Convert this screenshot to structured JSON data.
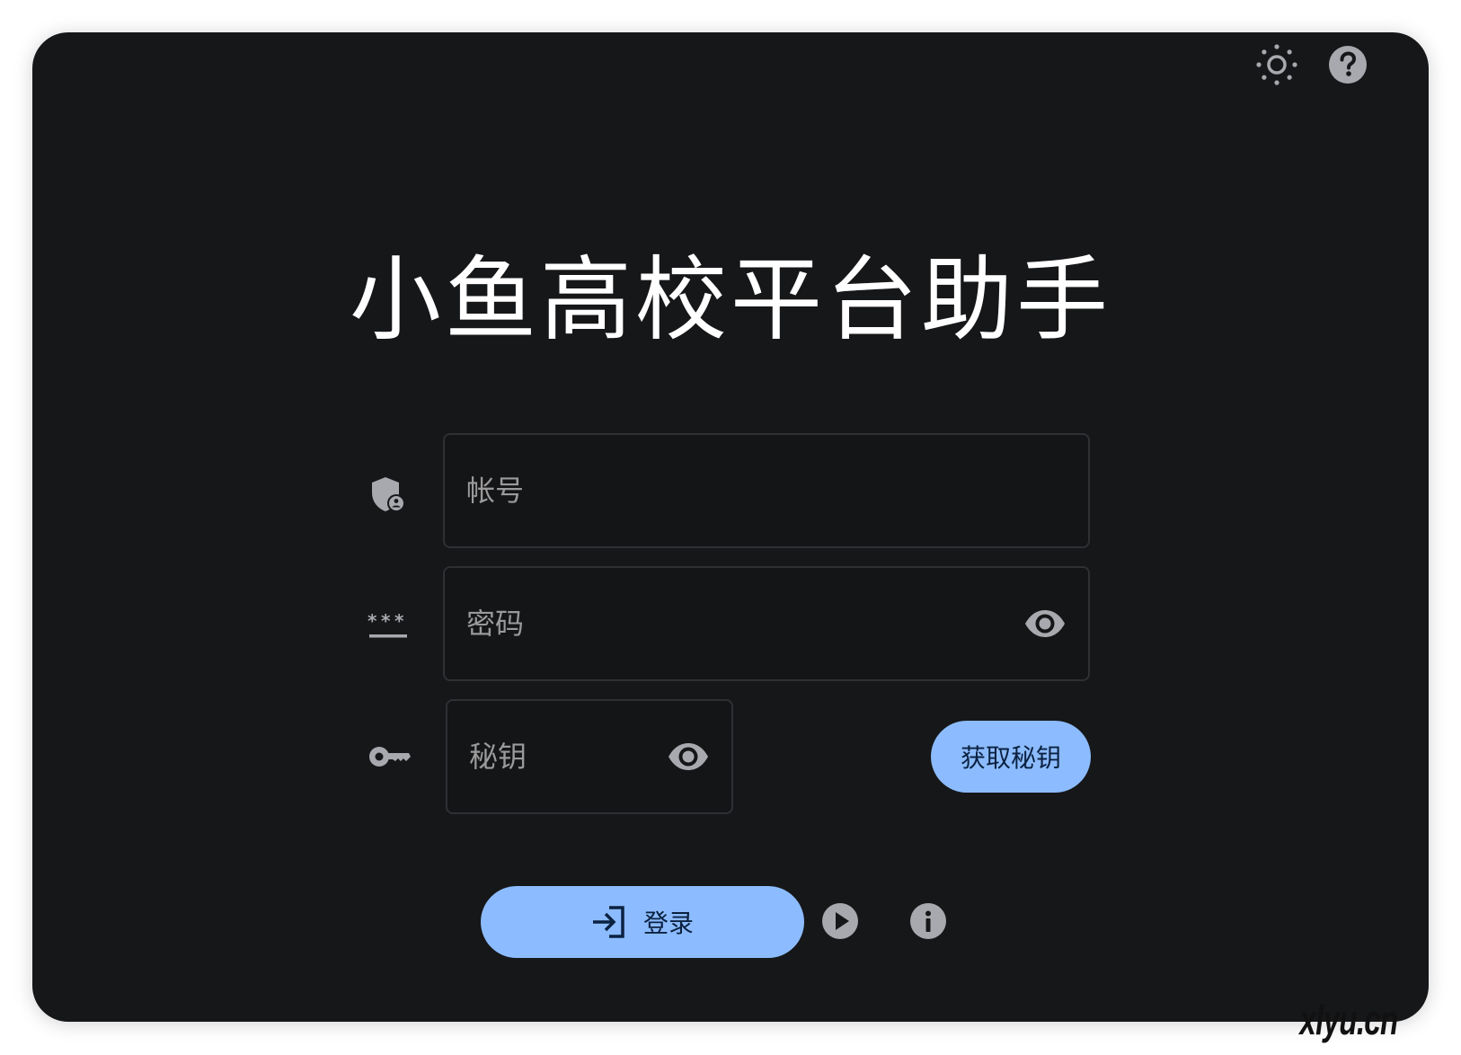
{
  "app": {
    "title": "小鱼高校平台助手"
  },
  "topbar": {
    "theme_icon": "sun-icon",
    "help_icon": "help-circle-icon"
  },
  "form": {
    "account": {
      "icon": "shield-person-icon",
      "placeholder": "帐号",
      "value": ""
    },
    "password": {
      "icon": "password-asterisk-icon",
      "placeholder": "密码",
      "value": "",
      "toggle_icon": "eye-icon"
    },
    "secret": {
      "icon": "key-icon",
      "placeholder": "秘钥",
      "value": "",
      "toggle_icon": "eye-icon"
    },
    "get_secret_label": "获取秘钥",
    "login_label": "登录",
    "login_icon": "login-arrow-icon"
  },
  "actions": {
    "play_icon": "play-circle-icon",
    "info_icon": "info-circle-icon"
  },
  "watermark": "xlyu.cn",
  "colors": {
    "background": "#161719",
    "accent": "#8cbcff",
    "icon_gray": "#a7a9ae",
    "text_primary": "#ffffff",
    "placeholder": "#9a9a9a"
  }
}
